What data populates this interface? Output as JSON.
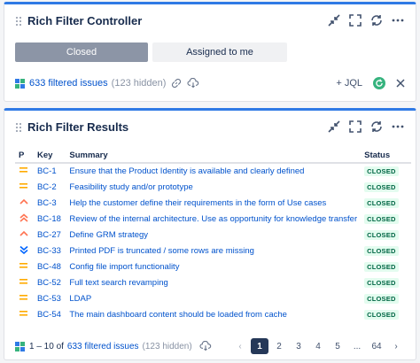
{
  "controller": {
    "title": "Rich Filter Controller",
    "tabs": [
      {
        "label": "Closed",
        "active": true
      },
      {
        "label": "Assigned to me",
        "active": false
      }
    ],
    "filtered_count": "633 filtered issues",
    "hidden_count": "(123 hidden)",
    "jql_label": "+ JQL"
  },
  "results": {
    "title": "Rich Filter Results",
    "columns": [
      "P",
      "Key",
      "Summary",
      "Status"
    ],
    "rows": [
      {
        "priority": "medium",
        "key": "BC-1",
        "summary": "Ensure that the Product Identity is available and clearly defined",
        "status": "CLOSED"
      },
      {
        "priority": "medium",
        "key": "BC-2",
        "summary": "Feasibility study and/or prototype",
        "status": "CLOSED"
      },
      {
        "priority": "high",
        "key": "BC-3",
        "summary": "Help the customer define their requirements in the form of Use cases",
        "status": "CLOSED"
      },
      {
        "priority": "highest",
        "key": "BC-18",
        "summary": "Review of the internal architecture. Use as opportunity for knowledge transfer",
        "status": "CLOSED"
      },
      {
        "priority": "high",
        "key": "BC-27",
        "summary": "Define GRM strategy",
        "status": "CLOSED"
      },
      {
        "priority": "lowest",
        "key": "BC-33",
        "summary": "Printed PDF is truncated / some rows are missing",
        "status": "CLOSED"
      },
      {
        "priority": "medium",
        "key": "BC-48",
        "summary": "Config file import functionality",
        "status": "CLOSED"
      },
      {
        "priority": "medium",
        "key": "BC-52",
        "summary": "Full text search revamping",
        "status": "CLOSED"
      },
      {
        "priority": "medium",
        "key": "BC-53",
        "summary": "LDAP",
        "status": "CLOSED"
      },
      {
        "priority": "medium",
        "key": "BC-54",
        "summary": "The main dashboard content should be loaded from cache",
        "status": "CLOSED"
      }
    ],
    "footer": {
      "range": "1 – 10 of",
      "filtered_count": "633 filtered issues",
      "hidden_count": "(123 hidden)"
    },
    "pagination": {
      "pages": [
        "1",
        "2",
        "3",
        "4",
        "5",
        "...",
        "64"
      ],
      "current": "1"
    }
  },
  "colors": {
    "accent": "#2f7ae5",
    "link": "#0052cc",
    "medium_priority": "#ffab00",
    "high_priority": "#ff7452",
    "lowest_priority": "#0065ff",
    "status_bg": "#e3fcef",
    "status_text": "#006644",
    "refresh": "#36b37e"
  },
  "icons": {
    "header": [
      "minimize-icon",
      "fullscreen-icon",
      "sync-icon",
      "more-icon"
    ],
    "filter_row": [
      "link-icon",
      "cloud-download-icon"
    ]
  }
}
